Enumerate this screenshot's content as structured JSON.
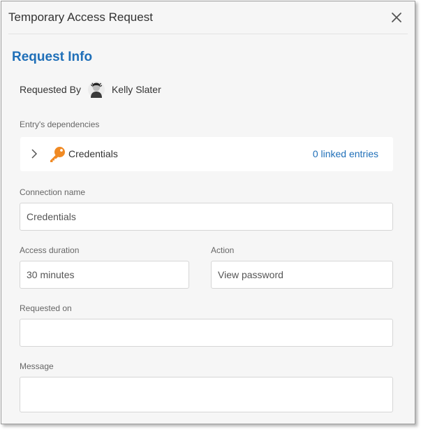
{
  "dialog": {
    "title": "Temporary Access Request",
    "close_icon": "close-icon"
  },
  "request_info": {
    "heading": "Request Info",
    "requested_by_label": "Requested By",
    "requested_by_user": "Kelly Slater",
    "avatar_icon": "user-avatar"
  },
  "dependencies": {
    "label": "Entry's dependencies",
    "entry_name": "Credentials",
    "entry_icon": "key-icon",
    "linked_entries": "0 linked entries"
  },
  "fields": {
    "connection_name": {
      "label": "Connection name",
      "value": "Credentials"
    },
    "access_duration": {
      "label": "Access duration",
      "value": "30 minutes"
    },
    "action": {
      "label": "Action",
      "value": "View password"
    },
    "requested_on": {
      "label": "Requested on",
      "value": ""
    },
    "message": {
      "label": "Message",
      "value": ""
    }
  },
  "colors": {
    "accent": "#1f6fb8",
    "key_orange": "#f08a24",
    "background": "#f6f6f6"
  }
}
